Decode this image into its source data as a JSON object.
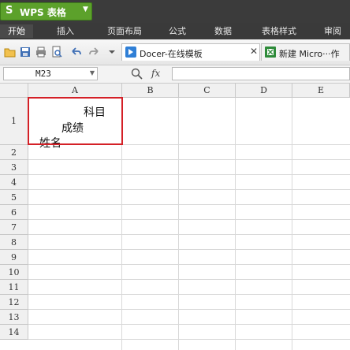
{
  "app": {
    "name": "WPS 表格",
    "logo": "S"
  },
  "ribbon_tabs": [
    "开始",
    "插入",
    "页面布局",
    "公式",
    "数据",
    "表格样式",
    "审阅"
  ],
  "toolbar": {
    "icons": [
      "open-folder-icon",
      "save-icon",
      "print-icon",
      "print-preview-icon",
      "undo-icon",
      "redo-icon",
      "dropdown-icon"
    ],
    "doc_tabs": [
      {
        "label": "Docer-在线模板",
        "closable": true
      },
      {
        "label": "新建 Micro···作"
      }
    ]
  },
  "formula_bar": {
    "cell_ref": "M23",
    "fx": "fx",
    "formula": ""
  },
  "grid": {
    "columns": [
      "A",
      "B",
      "C",
      "D",
      "E"
    ],
    "rows": [
      "1",
      "2",
      "3",
      "4",
      "5",
      "6",
      "7",
      "8",
      "9",
      "10",
      "11",
      "12",
      "13",
      "14"
    ],
    "cell_A1": {
      "line1": "科目",
      "line2": "成绩",
      "line3": "姓名"
    }
  },
  "colors": {
    "accent_green": "#5ca12b",
    "highlight_red": "#d42027",
    "dark_bar": "#3b3b3b"
  }
}
